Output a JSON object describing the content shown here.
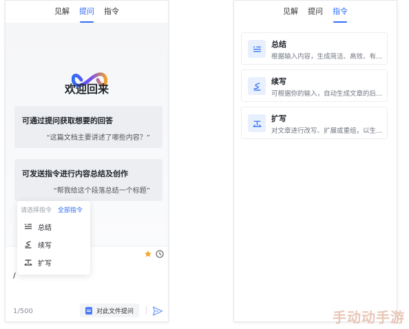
{
  "left_panel": {
    "tabs": [
      {
        "label": "见解",
        "active": false
      },
      {
        "label": "提问",
        "active": true
      },
      {
        "label": "指令",
        "active": false
      }
    ],
    "welcome_title": "欢迎回来",
    "cards": [
      {
        "title": "可通过提问获取想要的回答",
        "example": "“这篇文档主要讲述了哪些内容？”"
      },
      {
        "title": "可发送指令进行内容总结及创作",
        "example": "“帮我给这个段落总结一个标题”"
      }
    ],
    "command_popup": {
      "tab_inactive": "请选择指令",
      "tab_active": "全部指令",
      "items": [
        {
          "label": "总结",
          "icon": "summary-icon"
        },
        {
          "label": "续写",
          "icon": "continue-write-icon"
        },
        {
          "label": "扩写",
          "icon": "expand-write-icon"
        }
      ]
    },
    "input": {
      "value": "/",
      "counter": "1/500",
      "file_button_label": "对此文件提问"
    }
  },
  "right_panel": {
    "tabs": [
      {
        "label": "见解",
        "active": false
      },
      {
        "label": "提问",
        "active": false
      },
      {
        "label": "指令",
        "active": true
      }
    ],
    "commands": [
      {
        "title": "总结",
        "desc": "根据输入内容，生成简洁、高效、有...",
        "icon": "summary-icon"
      },
      {
        "title": "续写",
        "desc": "可根据你的输入，自动生成文章的后...",
        "icon": "continue-write-icon"
      },
      {
        "title": "扩写",
        "desc": "对文章进行改写、扩展或重组，以生...",
        "icon": "expand-write-icon"
      }
    ]
  },
  "watermark": "手动动手游",
  "colors": {
    "accent": "#2f6df6",
    "card_bg": "#eceef1",
    "star": "#f5a623"
  }
}
